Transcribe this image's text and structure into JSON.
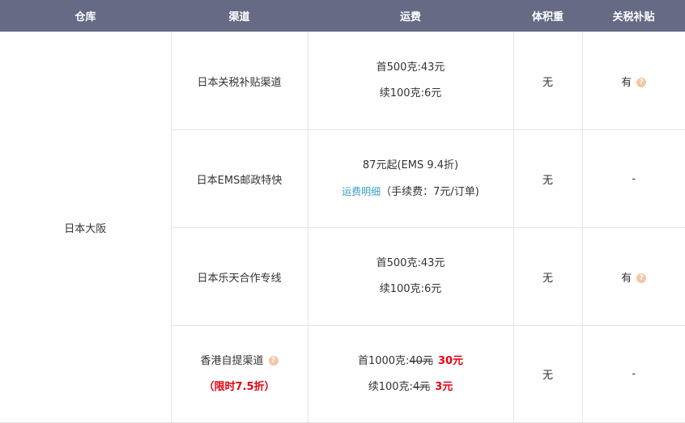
{
  "headers": {
    "warehouse": "仓库",
    "channel": "渠道",
    "freight": "运费",
    "volume": "体积重",
    "subsidy": "关税补贴"
  },
  "warehouse": "日本大阪",
  "help_icon_glyph": "?",
  "rows": [
    {
      "channel": "日本关税补贴渠道",
      "freight_line1": "首500克:43元",
      "freight_line2": "续100克:6元",
      "volume": "无",
      "subsidy": "有"
    },
    {
      "channel": "日本EMS邮政特快",
      "freight_line1": "87元起(EMS 9.4折)",
      "detail_link": "运费明细",
      "freight_line2_suffix": "（手续费：7元/订单)",
      "volume": "无",
      "subsidy": "-"
    },
    {
      "channel": "日本乐天合作专线",
      "freight_line1": "首500克:43元",
      "freight_line2": "续100克:6元",
      "volume": "无",
      "subsidy": "有"
    },
    {
      "channel": "香港自提渠道",
      "promo_note": "（限时7.5折）",
      "freight_first_label": "首1000克:",
      "freight_first_old": "40元",
      "freight_first_new": "30元",
      "freight_next_label": "续100克:",
      "freight_next_old": "4元",
      "freight_next_new": "3元",
      "volume": "无",
      "subsidy": "-"
    }
  ],
  "colors": {
    "header_bg": "#666a85",
    "border": "#e5e5e5",
    "link": "#3a9fc6",
    "promo": "#e60012",
    "help_icon": "#f5c6a5"
  }
}
